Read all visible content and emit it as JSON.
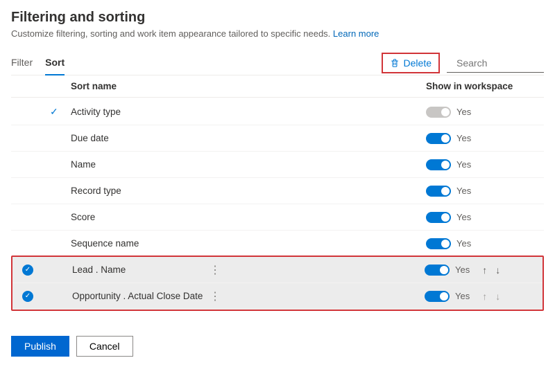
{
  "header": {
    "title": "Filtering and sorting",
    "subtitle": "Customize filtering, sorting and work item appearance tailored to specific needs.",
    "learn_more": "Learn more"
  },
  "tabs": {
    "filter": "Filter",
    "sort": "Sort"
  },
  "toolbar": {
    "delete": "Delete",
    "search_placeholder": "Search"
  },
  "columns": {
    "name": "Sort name",
    "show": "Show in workspace"
  },
  "rows": [
    {
      "name": "Activity type",
      "toggle": "yes-disabled",
      "selected": false,
      "default": true
    },
    {
      "name": "Due date",
      "toggle": "yes",
      "selected": false
    },
    {
      "name": "Name",
      "toggle": "yes",
      "selected": false
    },
    {
      "name": "Record type",
      "toggle": "yes",
      "selected": false
    },
    {
      "name": "Score",
      "toggle": "yes",
      "selected": false
    },
    {
      "name": "Sequence name",
      "toggle": "yes",
      "selected": false
    },
    {
      "name": "Lead . Name",
      "toggle": "yes",
      "selected": true,
      "arrows": "enabled"
    },
    {
      "name": "Opportunity . Actual Close Date",
      "toggle": "yes",
      "selected": true,
      "arrows": "dim"
    }
  ],
  "toggle_label": "Yes",
  "buttons": {
    "publish": "Publish",
    "cancel": "Cancel"
  }
}
